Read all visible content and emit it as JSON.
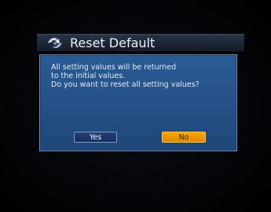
{
  "dialog": {
    "title": "Reset Default",
    "title_icon": "reset-swirl-icon",
    "message_lines": [
      "All setting values will be returned",
      "to the initial values.",
      "Do you want to reset all setting values?"
    ],
    "buttons": {
      "yes": "Yes",
      "no": "No"
    },
    "focused_button": "No"
  },
  "colors": {
    "screen_background": "#000000",
    "title_bar": "#1d2536",
    "dialog_panel": "#2a5b94",
    "dialog_border": "#6f8fb8",
    "button_yes": "#1c3568",
    "button_no_focused": "#f0a000",
    "text_light": "#e4ecf6"
  }
}
